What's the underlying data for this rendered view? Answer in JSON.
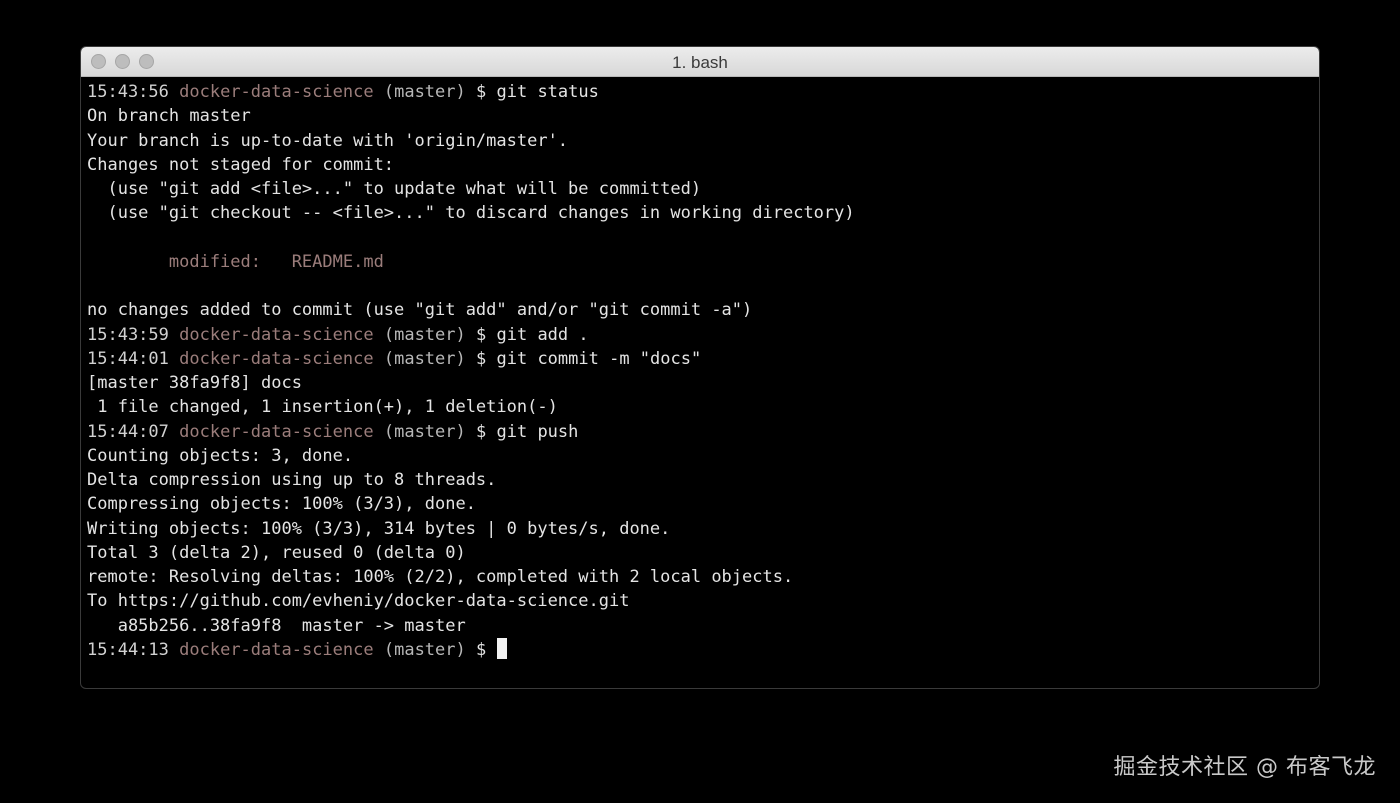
{
  "window": {
    "title": "1. bash"
  },
  "terminal": {
    "lines": [
      {
        "kind": "prompt",
        "time": "15:43:56",
        "dir": "docker-data-science",
        "branch": "(master)",
        "sym": "$",
        "cmd": "git status"
      },
      {
        "kind": "text",
        "text": "On branch master"
      },
      {
        "kind": "text",
        "text": "Your branch is up-to-date with 'origin/master'."
      },
      {
        "kind": "text",
        "text": "Changes not staged for commit:"
      },
      {
        "kind": "text",
        "text": "  (use \"git add <file>...\" to update what will be committed)"
      },
      {
        "kind": "text",
        "text": "  (use \"git checkout -- <file>...\" to discard changes in working directory)"
      },
      {
        "kind": "text",
        "text": ""
      },
      {
        "kind": "modified",
        "text": "        modified:   README.md"
      },
      {
        "kind": "text",
        "text": ""
      },
      {
        "kind": "text",
        "text": "no changes added to commit (use \"git add\" and/or \"git commit -a\")"
      },
      {
        "kind": "prompt",
        "time": "15:43:59",
        "dir": "docker-data-science",
        "branch": "(master)",
        "sym": "$",
        "cmd": "git add ."
      },
      {
        "kind": "prompt",
        "time": "15:44:01",
        "dir": "docker-data-science",
        "branch": "(master)",
        "sym": "$",
        "cmd": "git commit -m \"docs\""
      },
      {
        "kind": "text",
        "text": "[master 38fa9f8] docs"
      },
      {
        "kind": "text",
        "text": " 1 file changed, 1 insertion(+), 1 deletion(-)"
      },
      {
        "kind": "prompt",
        "time": "15:44:07",
        "dir": "docker-data-science",
        "branch": "(master)",
        "sym": "$",
        "cmd": "git push"
      },
      {
        "kind": "text",
        "text": "Counting objects: 3, done."
      },
      {
        "kind": "text",
        "text": "Delta compression using up to 8 threads."
      },
      {
        "kind": "text",
        "text": "Compressing objects: 100% (3/3), done."
      },
      {
        "kind": "text",
        "text": "Writing objects: 100% (3/3), 314 bytes | 0 bytes/s, done."
      },
      {
        "kind": "text",
        "text": "Total 3 (delta 2), reused 0 (delta 0)"
      },
      {
        "kind": "text",
        "text": "remote: Resolving deltas: 100% (2/2), completed with 2 local objects."
      },
      {
        "kind": "text",
        "text": "To https://github.com/evheniy/docker-data-science.git"
      },
      {
        "kind": "text",
        "text": "   a85b256..38fa9f8  master -> master"
      },
      {
        "kind": "prompt",
        "time": "15:44:13",
        "dir": "docker-data-science",
        "branch": "(master)",
        "sym": "$",
        "cmd": "",
        "cursor": true
      }
    ]
  },
  "watermark": {
    "text": "掘金技术社区 @ 布客飞龙"
  },
  "colors": {
    "background": "#000000",
    "text": "#e4e4e4",
    "directory": "#9b7d7b",
    "modified": "#9b7d7b",
    "titlebar": "#e0e0e0"
  }
}
